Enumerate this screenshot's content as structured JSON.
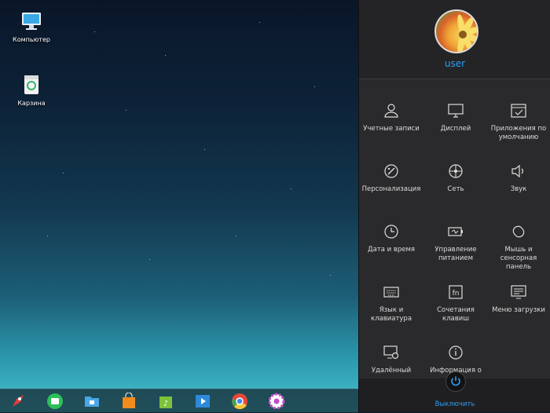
{
  "desktop": {
    "icons": [
      {
        "label": "Компьютер",
        "icon": "computer-icon"
      },
      {
        "label": "Карзина",
        "icon": "trash-icon"
      }
    ]
  },
  "dock": {
    "apps": [
      {
        "icon": "launcher-rocket-icon"
      },
      {
        "icon": "app-store-icon"
      },
      {
        "icon": "file-manager-icon"
      },
      {
        "icon": "shopping-bag-icon"
      },
      {
        "icon": "music-player-icon"
      },
      {
        "icon": "video-player-icon"
      },
      {
        "icon": "chrome-icon"
      },
      {
        "icon": "settings-gear-icon"
      }
    ]
  },
  "panel": {
    "user": {
      "name": "user"
    },
    "tiles": [
      {
        "label": "Учетные записи",
        "icon": "user-accounts-icon"
      },
      {
        "label": "Дисплей",
        "icon": "display-icon"
      },
      {
        "label": "Приложения по умолчанию",
        "icon": "default-apps-icon"
      },
      {
        "label": "Персонализация",
        "icon": "personalization-icon"
      },
      {
        "label": "Сеть",
        "icon": "network-icon"
      },
      {
        "label": "Звук",
        "icon": "sound-icon"
      },
      {
        "label": "Дата и время",
        "icon": "clock-icon"
      },
      {
        "label": "Управление питанием",
        "icon": "power-management-icon"
      },
      {
        "label": "Мышь и сенсорная панель",
        "icon": "mouse-icon"
      },
      {
        "label": "Язык и клавиатура",
        "icon": "keyboard-icon"
      },
      {
        "label": "Сочетания клавиш",
        "icon": "shortcuts-icon"
      },
      {
        "label": "Меню загрузки",
        "icon": "boot-menu-icon"
      },
      {
        "label": "Удалённый",
        "icon": "remote-icon"
      },
      {
        "label": "Информация о",
        "icon": "info-icon"
      }
    ],
    "power": {
      "label": "Выключить",
      "icon": "power-icon"
    }
  },
  "colors": {
    "accent": "#2a9ff2",
    "panel_bg": "#2a2a2c"
  }
}
